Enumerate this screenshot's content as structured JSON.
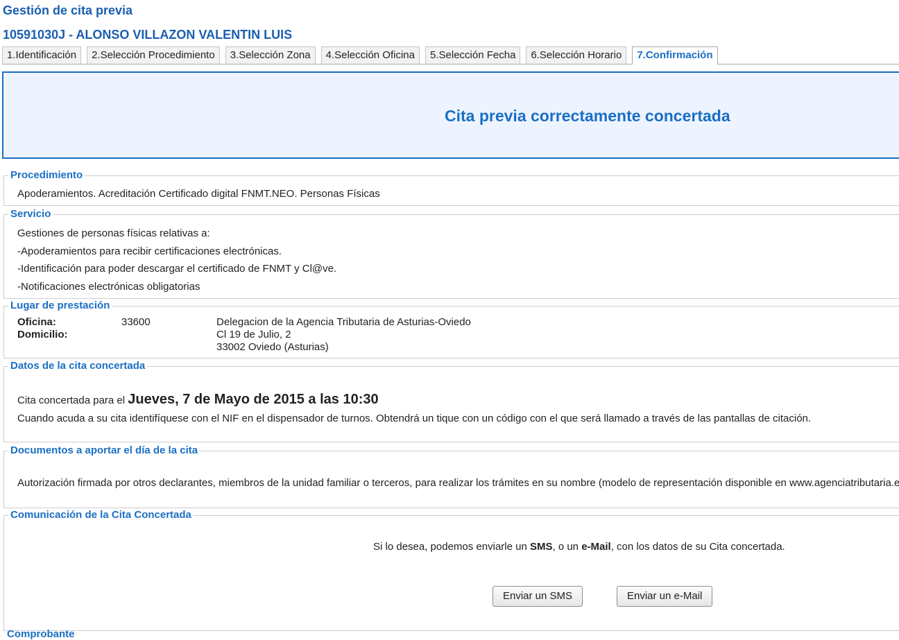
{
  "header": {
    "title": "Gestión de cita previa",
    "user": "10591030J - ALONSO VILLAZON VALENTIN LUIS"
  },
  "tabs": [
    {
      "label": "1.Identificación"
    },
    {
      "label": "2.Selección Procedimiento"
    },
    {
      "label": "3.Selección Zona"
    },
    {
      "label": "4.Selección Oficina"
    },
    {
      "label": "5.Selección Fecha"
    },
    {
      "label": "6.Selección Horario"
    },
    {
      "label": "7.Confirmación",
      "active": true
    }
  ],
  "banner": {
    "message": "Cita previa correctamente concertada"
  },
  "procedimiento": {
    "legend": "Procedimiento",
    "text": "Apoderamientos. Acreditación Certificado digital FNMT.NEO. Personas Físicas"
  },
  "servicio": {
    "legend": "Servicio",
    "lines": [
      "Gestiones de personas físicas relativas a:",
      "-Apoderamientos para recibir certificaciones electrónicas.",
      "-Identificación para poder descargar el certificado de FNMT y Cl@ve.",
      "-Notificaciones electrónicas obligatorias"
    ]
  },
  "lugar": {
    "legend": "Lugar de prestación",
    "oficina_label": "Oficina:",
    "oficina_code": "33600",
    "oficina_name": "Delegacion de la Agencia Tributaria de Asturias-Oviedo",
    "domicilio_label": "Domicilio:",
    "domicilio_line1": "Cl 19 de Julio, 2",
    "domicilio_line2": "33002 Oviedo (Asturias)"
  },
  "datos": {
    "legend": "Datos de la cita concertada",
    "prefix": "Cita concertada para el",
    "fecha": "Jueves, 7 de Mayo de 2015 a las 10:30",
    "info": "Cuando acuda a su cita identifíquese con el NIF en el dispensador de turnos. Obtendrá un tique con un código con el que será llamado a través de las pantallas de citación."
  },
  "documentos": {
    "legend": "Documentos a aportar el día de la cita",
    "text": "Autorización firmada por otros declarantes, miembros de la unidad familiar o terceros, para realizar los trámites en su nombre (modelo de representación disponible en www.agenciatributaria.es)"
  },
  "comunicacion": {
    "legend": "Comunicación de la Cita Concertada",
    "text_pre": "Si lo desea, podemos enviarle un ",
    "sms_word": "SMS",
    "text_mid": ", o un ",
    "email_word": "e-Mail",
    "text_post": ", con los datos de su Cita concertada.",
    "sms_button": "Enviar un SMS",
    "email_button": "Enviar un e-Mail"
  },
  "next_section_partial": "Comprobante"
}
